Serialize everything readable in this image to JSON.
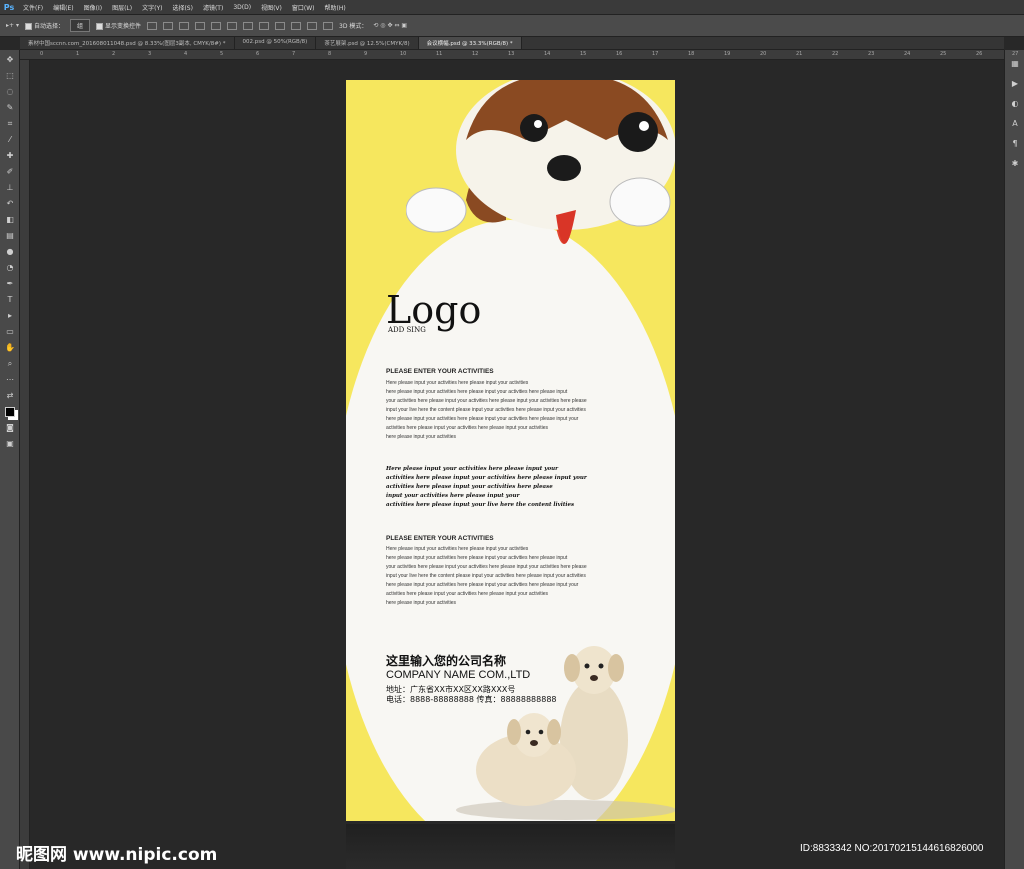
{
  "app": {
    "logo": "Ps"
  },
  "menu": [
    "文件(F)",
    "编辑(E)",
    "图像(I)",
    "图层(L)",
    "文字(Y)",
    "选择(S)",
    "滤镜(T)",
    "3D(D)",
    "视图(V)",
    "窗口(W)",
    "帮助(H)"
  ],
  "options": {
    "auto_select": "自动选择：",
    "group_value": "组",
    "show_transform": "显示变换控件",
    "mode_3d": "3D 模式："
  },
  "tabs": [
    {
      "label": "素材中国sccnn.com_201608011048.psd @ 8.33%(图层3副本, CMYK/8#) *",
      "active": false
    },
    {
      "label": "002.psd @ 50%(RGB/8)",
      "active": false
    },
    {
      "label": "茶艺展架.psd @ 12.5%(CMYK/8)",
      "active": false
    },
    {
      "label": "会议横幅.psd @ 33.3%(RGB/8) *",
      "active": true
    }
  ],
  "ruler_ticks": [
    "0",
    "1",
    "2",
    "3",
    "4",
    "5",
    "6",
    "7",
    "8",
    "9",
    "10",
    "11",
    "12",
    "13",
    "14",
    "15",
    "16",
    "17",
    "18",
    "19",
    "20",
    "21",
    "22",
    "23",
    "24",
    "25",
    "26",
    "27"
  ],
  "tools": [
    "move-icon",
    "marquee-icon",
    "lasso-icon",
    "quick-select-icon",
    "crop-icon",
    "eyedropper-icon",
    "healing-icon",
    "brush-icon",
    "stamp-icon",
    "history-brush-icon",
    "eraser-icon",
    "gradient-icon",
    "blur-icon",
    "dodge-icon",
    "pen-icon",
    "type-icon",
    "path-select-icon",
    "shape-icon",
    "hand-icon",
    "zoom-icon",
    "more-icon",
    "swap-colors-icon",
    "foreground-color-icon",
    "quickmask-icon",
    "screen-mode-icon"
  ],
  "poster": {
    "logo": "Logo",
    "logo_sub": "ADD SING",
    "heading1": "PLEASE ENTER YOUR ACTIVITIES",
    "body1": [
      "Here please input your activities here please input your activities",
      "here please input your activities here please input your activities here please input",
      "your activities here please input your activities here please input your activities here please",
      "input your live here the content please input your activities here please input your activities",
      "here please input your activities here please input your activities here please input your",
      " activities here please input your activities here please input your activities",
      "here please input your activities"
    ],
    "script": [
      "Here please input your activities here please input your",
      "activities here please input your activities here please input your",
      "activities here please input your activities here please",
      "input your activities here please input your",
      "activities here please input your live here the content livities"
    ],
    "heading2": "PLEASE ENTER YOUR ACTIVITIES",
    "body2": [
      "Here please input your activities here please input your activities",
      "here please input your activities here please input your activities here please input",
      "your activities here please input your activities here please input your activities here please",
      "input your live here the content please input your activities here please input your activities",
      "here please input your activities here please input your activities here please input your",
      " activities here please input your activities here please input your activities",
      "here please input your activities"
    ],
    "company_cn": "这里输入您的公司名称",
    "company_en": "COMPANY NAME COM.,LTD",
    "address": "地址：广东省XX市XX区XX路XXX号",
    "phone": "电话：8888-88888888  传真：88888888888"
  },
  "watermark": {
    "left": "昵图网 www.nipic.com",
    "right": "ID:8833342 NO:20170215144616826000"
  },
  "colors": {
    "poster_bg": "#f6e75e",
    "ellipse": "#f8f7f3",
    "accent": "#59b4ff"
  }
}
